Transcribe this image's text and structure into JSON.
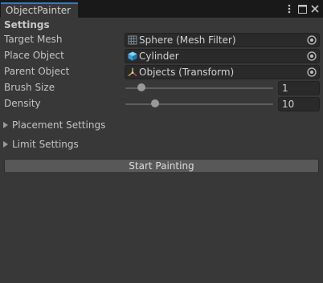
{
  "window": {
    "tab_title": "ObjectPainter"
  },
  "settings": {
    "header": "Settings",
    "target_mesh": {
      "label": "Target Mesh",
      "value": "Sphere (Mesh Filter)",
      "icon": "mesh-filter-icon"
    },
    "place_object": {
      "label": "Place Object",
      "value": "Cylinder",
      "icon": "cube-icon"
    },
    "parent_object": {
      "label": "Parent Object",
      "value": "Objects (Transform)",
      "icon": "transform-icon"
    },
    "brush_size": {
      "label": "Brush Size",
      "value": "1",
      "slider_fraction": 0.11
    },
    "density": {
      "label": "Density",
      "value": "10",
      "slider_fraction": 0.2
    }
  },
  "foldouts": {
    "placement": "Placement Settings",
    "limit": "Limit Settings"
  },
  "actions": {
    "start_painting": "Start Painting"
  },
  "colors": {
    "tab_accent": "#3a79bb",
    "background": "#383838",
    "field": "#2a2a2a",
    "button": "#585858"
  }
}
